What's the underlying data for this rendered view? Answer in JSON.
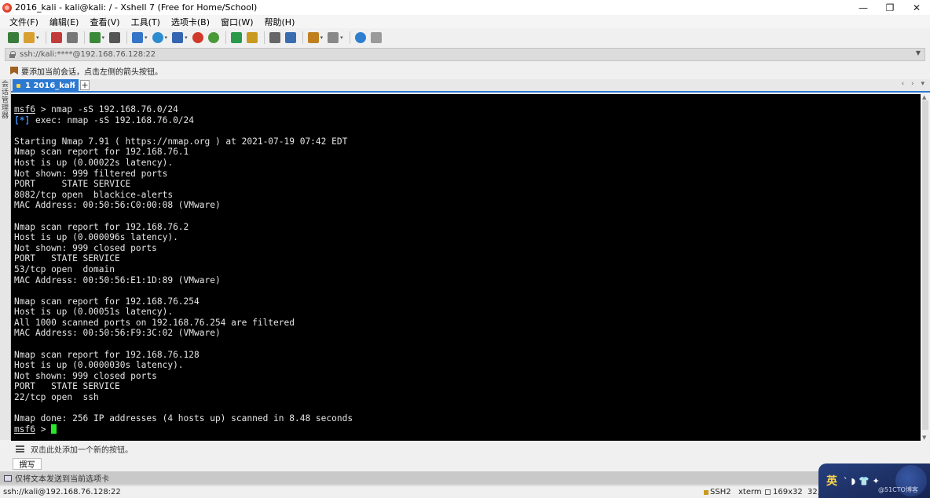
{
  "window": {
    "title": "2016_kali - kali@kali: / - Xshell 7 (Free for Home/School)",
    "controls": [
      "—",
      "❐",
      "✕"
    ]
  },
  "menu": [
    "文件(F)",
    "编辑(E)",
    "查看(V)",
    "工具(T)",
    "选项卡(B)",
    "窗口(W)",
    "帮助(H)"
  ],
  "toolbar_icons": [
    {
      "name": "new-session-icon",
      "color": "#3a7d3a"
    },
    {
      "name": "open-folder-icon",
      "color": "#d8a030"
    },
    {
      "name": "reconnect-icon",
      "color": "#c23b3b"
    },
    {
      "name": "disconnect-icon",
      "color": "#777777"
    },
    {
      "name": "new-tab-icon",
      "color": "#3a8a3a"
    },
    {
      "name": "find-icon",
      "color": "#555555"
    },
    {
      "name": "properties-icon",
      "color": "#3575c7"
    },
    {
      "name": "globe-icon",
      "color": "#2d8bd0"
    },
    {
      "name": "font-icon",
      "color": "#3465b0"
    },
    {
      "name": "xftp-icon",
      "color": "#d03a2a"
    },
    {
      "name": "xmanager-icon",
      "color": "#4a9a3a"
    },
    {
      "name": "fullscreen-icon",
      "color": "#2a9a4a"
    },
    {
      "name": "lock-icon",
      "color": "#c89a20"
    },
    {
      "name": "keyboard-icon",
      "color": "#666666"
    },
    {
      "name": "script-icon",
      "color": "#3a6db0"
    },
    {
      "name": "folder-transfer-icon",
      "color": "#c08020"
    },
    {
      "name": "layout-icon",
      "color": "#888888"
    },
    {
      "name": "help-icon",
      "color": "#2f7fd0"
    },
    {
      "name": "chat-icon",
      "color": "#9a9a9a"
    }
  ],
  "address": "ssh://kali:****@192.168.76.128:22",
  "info_text": "要添加当前会话，点击左侧的箭头按钮。",
  "sidebar_label": "会话管理器",
  "tab": {
    "label": "1 2016_kali",
    "close": "×",
    "add": "+",
    "nav": "‹ › ▾"
  },
  "terminal": {
    "lines": [
      {
        "parts": [
          {
            "t": "msf6",
            "c": "u"
          },
          {
            "t": " > nmap -sS 192.168.76.0/24"
          }
        ]
      },
      {
        "parts": [
          {
            "t": "[*]",
            "c": "blue"
          },
          {
            "t": " exec: nmap -sS 192.168.76.0/24"
          }
        ]
      },
      {
        "parts": [
          {
            "t": ""
          }
        ]
      },
      {
        "parts": [
          {
            "t": "Starting Nmap 7.91 ( https://nmap.org ) at 2021-07-19 07:42 EDT"
          }
        ]
      },
      {
        "parts": [
          {
            "t": "Nmap scan report for 192.168.76.1"
          }
        ]
      },
      {
        "parts": [
          {
            "t": "Host is up (0.00022s latency)."
          }
        ]
      },
      {
        "parts": [
          {
            "t": "Not shown: 999 filtered ports"
          }
        ]
      },
      {
        "parts": [
          {
            "t": "PORT     STATE SERVICE"
          }
        ]
      },
      {
        "parts": [
          {
            "t": "8082/tcp open  blackice-alerts"
          }
        ]
      },
      {
        "parts": [
          {
            "t": "MAC Address: 00:50:56:C0:00:08 (VMware)"
          }
        ]
      },
      {
        "parts": [
          {
            "t": ""
          }
        ]
      },
      {
        "parts": [
          {
            "t": "Nmap scan report for 192.168.76.2"
          }
        ]
      },
      {
        "parts": [
          {
            "t": "Host is up (0.000096s latency)."
          }
        ]
      },
      {
        "parts": [
          {
            "t": "Not shown: 999 closed ports"
          }
        ]
      },
      {
        "parts": [
          {
            "t": "PORT   STATE SERVICE"
          }
        ]
      },
      {
        "parts": [
          {
            "t": "53/tcp open  domain"
          }
        ]
      },
      {
        "parts": [
          {
            "t": "MAC Address: 00:50:56:E1:1D:89 (VMware)"
          }
        ]
      },
      {
        "parts": [
          {
            "t": ""
          }
        ]
      },
      {
        "parts": [
          {
            "t": "Nmap scan report for 192.168.76.254"
          }
        ]
      },
      {
        "parts": [
          {
            "t": "Host is up (0.00051s latency)."
          }
        ]
      },
      {
        "parts": [
          {
            "t": "All 1000 scanned ports on 192.168.76.254 are filtered"
          }
        ]
      },
      {
        "parts": [
          {
            "t": "MAC Address: 00:50:56:F9:3C:02 (VMware)"
          }
        ]
      },
      {
        "parts": [
          {
            "t": ""
          }
        ]
      },
      {
        "parts": [
          {
            "t": "Nmap scan report for 192.168.76.128"
          }
        ]
      },
      {
        "parts": [
          {
            "t": "Host is up (0.0000030s latency)."
          }
        ]
      },
      {
        "parts": [
          {
            "t": "Not shown: 999 closed ports"
          }
        ]
      },
      {
        "parts": [
          {
            "t": "PORT   STATE SERVICE"
          }
        ]
      },
      {
        "parts": [
          {
            "t": "22/tcp open  ssh"
          }
        ]
      },
      {
        "parts": [
          {
            "t": ""
          }
        ]
      },
      {
        "parts": [
          {
            "t": "Nmap done: 256 IP addresses (4 hosts up) scanned in 8.48 seconds"
          }
        ]
      },
      {
        "parts": [
          {
            "t": "msf6",
            "c": "u"
          },
          {
            "t": " > "
          }
        ],
        "cursor": true
      }
    ]
  },
  "quickbar_text": "双击此处添加一个新的按钮。",
  "compose_label": "撰写",
  "send_text": "仅将文本发送到当前选项卡",
  "status": {
    "connection": "ssh://kali@192.168.76.128:22",
    "protocol": "SSH2",
    "term": "xterm",
    "size": "169x32",
    "pos": "32,"
  },
  "ime": {
    "lang": "英",
    "symbols": "ˋ ◗ 👕 ✦",
    "watermark": "@51CTO博客"
  }
}
